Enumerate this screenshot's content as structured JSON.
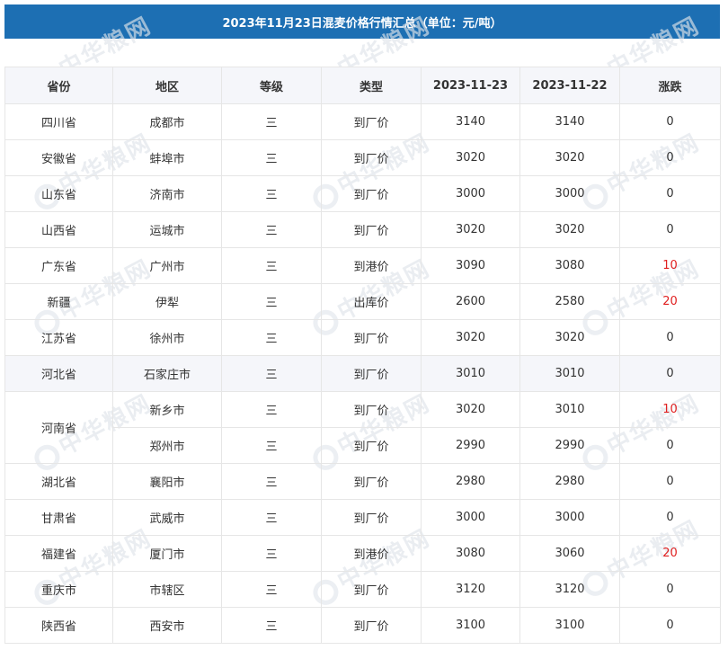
{
  "title": "2023年11月23日混麦价格行情汇总（单位：元/吨）",
  "watermark": "中华粮网",
  "colors": {
    "header_bg": "#1d6fb3",
    "up": "#e02020"
  },
  "table": {
    "headers": [
      "省份",
      "地区",
      "等级",
      "类型",
      "2023-11-23",
      "2023-11-22",
      "涨跌"
    ],
    "rows": [
      {
        "province": "四川省",
        "region": "成都市",
        "grade": "三",
        "type": "到厂价",
        "d1": "3140",
        "d2": "3140",
        "change": "0"
      },
      {
        "province": "安徽省",
        "region": "蚌埠市",
        "grade": "三",
        "type": "到厂价",
        "d1": "3020",
        "d2": "3020",
        "change": "0"
      },
      {
        "province": "山东省",
        "region": "济南市",
        "grade": "三",
        "type": "到厂价",
        "d1": "3000",
        "d2": "3000",
        "change": "0"
      },
      {
        "province": "山西省",
        "region": "运城市",
        "grade": "三",
        "type": "到厂价",
        "d1": "3020",
        "d2": "3020",
        "change": "0"
      },
      {
        "province": "广东省",
        "region": "广州市",
        "grade": "三",
        "type": "到港价",
        "d1": "3090",
        "d2": "3080",
        "change": "10"
      },
      {
        "province": "新疆",
        "region": "伊犁",
        "grade": "三",
        "type": "出库价",
        "d1": "2600",
        "d2": "2580",
        "change": "20"
      },
      {
        "province": "江苏省",
        "region": "徐州市",
        "grade": "三",
        "type": "到厂价",
        "d1": "3020",
        "d2": "3020",
        "change": "0"
      },
      {
        "province": "河北省",
        "region": "石家庄市",
        "grade": "三",
        "type": "到厂价",
        "d1": "3010",
        "d2": "3010",
        "change": "0"
      },
      {
        "province": "河南省",
        "region": "新乡市",
        "grade": "三",
        "type": "到厂价",
        "d1": "3020",
        "d2": "3010",
        "change": "10"
      },
      {
        "province": "",
        "region": "郑州市",
        "grade": "三",
        "type": "到厂价",
        "d1": "2990",
        "d2": "2990",
        "change": "0"
      },
      {
        "province": "湖北省",
        "region": "襄阳市",
        "grade": "三",
        "type": "到厂价",
        "d1": "2980",
        "d2": "2980",
        "change": "0"
      },
      {
        "province": "甘肃省",
        "region": "武威市",
        "grade": "三",
        "type": "到厂价",
        "d1": "3000",
        "d2": "3000",
        "change": "0"
      },
      {
        "province": "福建省",
        "region": "厦门市",
        "grade": "三",
        "type": "到港价",
        "d1": "3080",
        "d2": "3060",
        "change": "20"
      },
      {
        "province": "重庆市",
        "region": "市辖区",
        "grade": "三",
        "type": "到厂价",
        "d1": "3120",
        "d2": "3120",
        "change": "0"
      },
      {
        "province": "陕西省",
        "region": "西安市",
        "grade": "三",
        "type": "到厂价",
        "d1": "3100",
        "d2": "3100",
        "change": "0"
      }
    ]
  }
}
